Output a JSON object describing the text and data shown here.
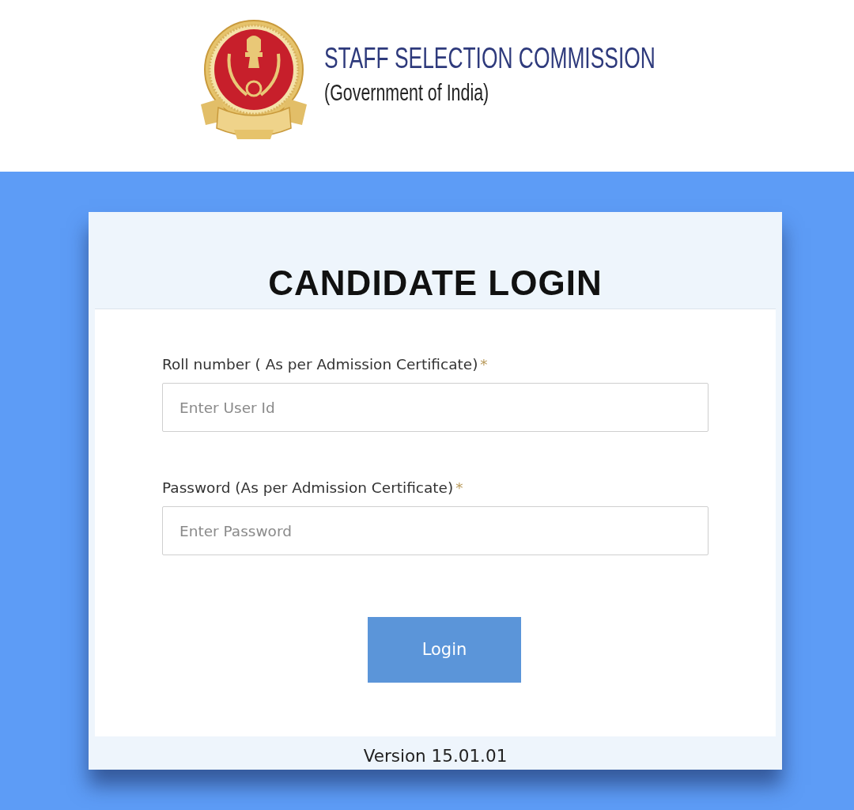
{
  "header": {
    "title": "STAFF SELECTION COMMISSION",
    "subtitle": "(Government of India)"
  },
  "login_card": {
    "title": "CANDIDATE LOGIN",
    "fields": [
      {
        "label": "Roll number ( As per Admission Certificate)",
        "required_mark": "*",
        "placeholder": "Enter User Id"
      },
      {
        "label": "Password (As per Admission Certificate)",
        "required_mark": "*",
        "placeholder": "Enter Password"
      }
    ],
    "button": "Login",
    "version": "Version 15.01.01"
  }
}
